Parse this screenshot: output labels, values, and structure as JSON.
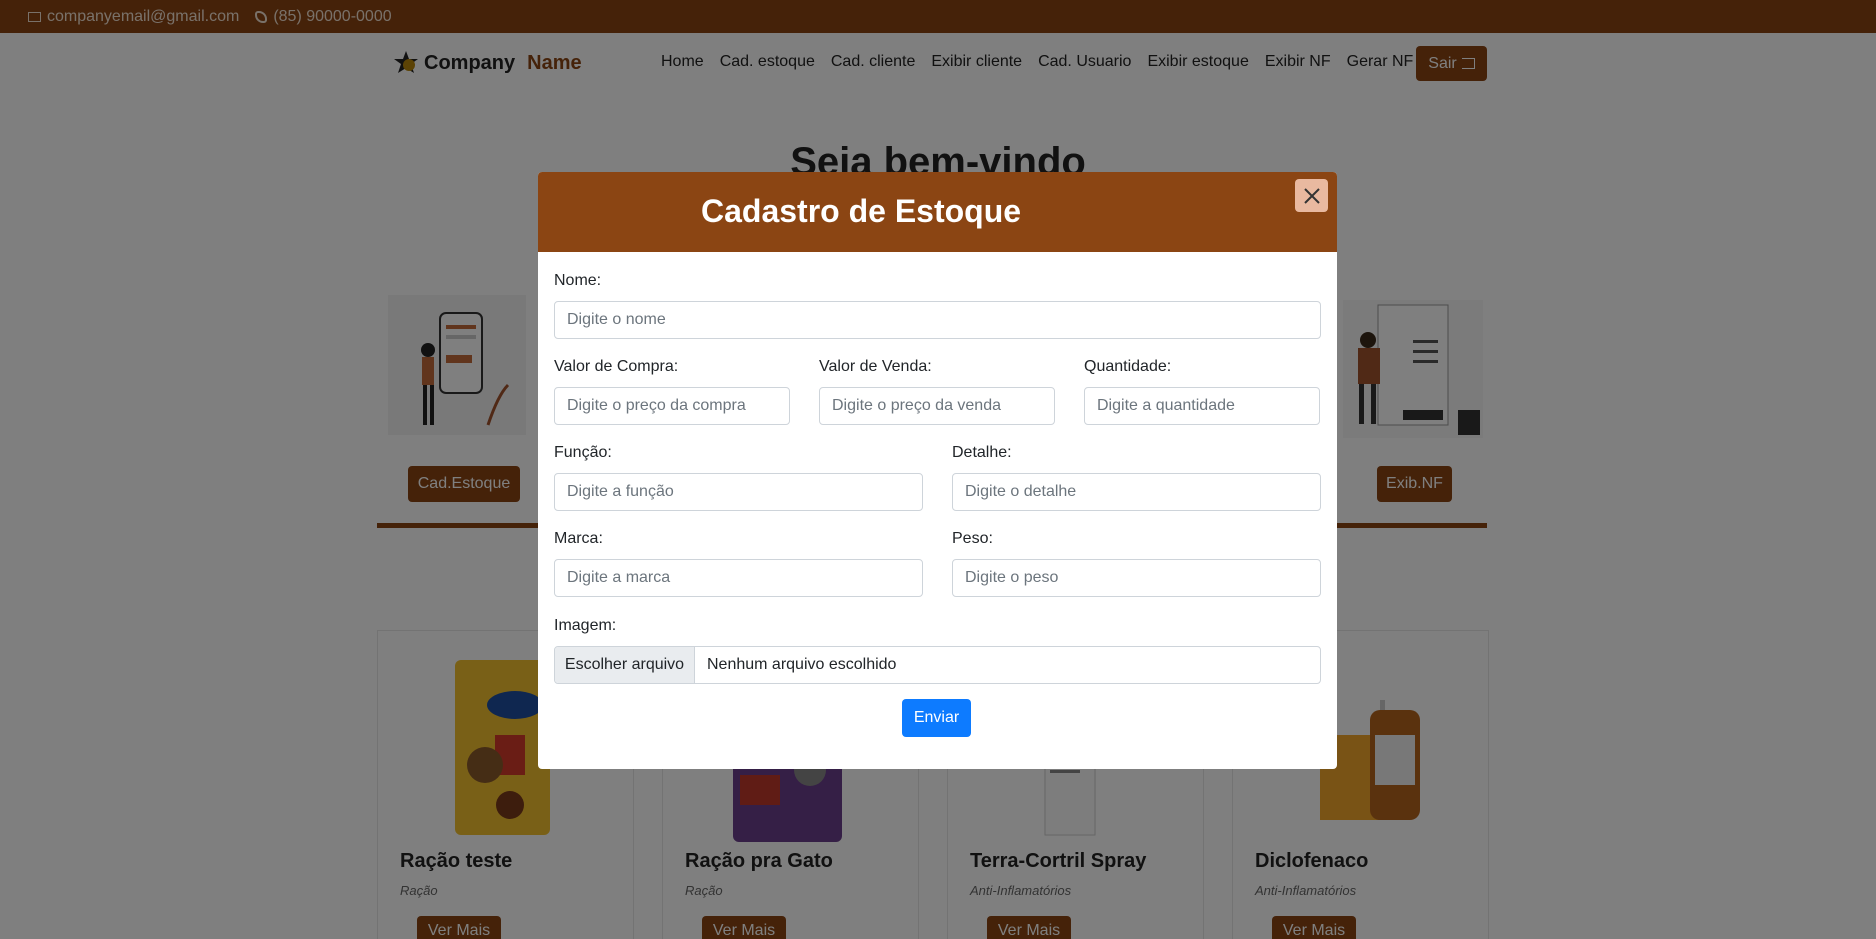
{
  "topbar": {
    "email": "companyemail@gmail.com",
    "phone": "(85) 90000-0000"
  },
  "brand": {
    "part1": "Company",
    "part2": "Name"
  },
  "nav": {
    "links": [
      "Home",
      "Cad. estoque",
      "Cad. cliente",
      "Exibir cliente",
      "Cad. Usuario",
      "Exibir estoque",
      "Exibir NF",
      "Gerar NF"
    ],
    "logout": "Sair"
  },
  "welcome": "Seja bem-vindo",
  "sections": {
    "btn_left": "Cad.Estoque",
    "btn_right": "Exib.NF"
  },
  "products": [
    {
      "title": "Ração teste",
      "category": "Ração",
      "button": "Ver Mais"
    },
    {
      "title": "Ração pra Gato",
      "category": "Ração",
      "button": "Ver Mais"
    },
    {
      "title": "Terra-Cortril Spray",
      "category": "Anti-Inflamatórios",
      "button": "Ver Mais"
    },
    {
      "title": "Diclofenaco",
      "category": "Anti-Inflamatórios",
      "button": "Ver Mais"
    }
  ],
  "modal": {
    "title": "Cadastro de Estoque",
    "fields": {
      "nome": {
        "label": "Nome:",
        "placeholder": "Digite o nome"
      },
      "valor_compra": {
        "label": "Valor de Compra:",
        "placeholder": "Digite o preço da compra"
      },
      "valor_venda": {
        "label": "Valor de Venda:",
        "placeholder": "Digite o preço da venda"
      },
      "quantidade": {
        "label": "Quantidade:",
        "placeholder": "Digite a quantidade"
      },
      "funcao": {
        "label": "Função:",
        "placeholder": "Digite a função"
      },
      "detalhe": {
        "label": "Detalhe:",
        "placeholder": "Digite o detalhe"
      },
      "marca": {
        "label": "Marca:",
        "placeholder": "Digite a marca"
      },
      "peso": {
        "label": "Peso:",
        "placeholder": "Digite o peso"
      },
      "imagem": {
        "label": "Imagem:",
        "button": "Escolher arquivo",
        "status": "Nenhum arquivo escolhido"
      }
    },
    "submit": "Enviar"
  },
  "colors": {
    "brand": "#8B4513",
    "primary": "#0d7bff"
  }
}
